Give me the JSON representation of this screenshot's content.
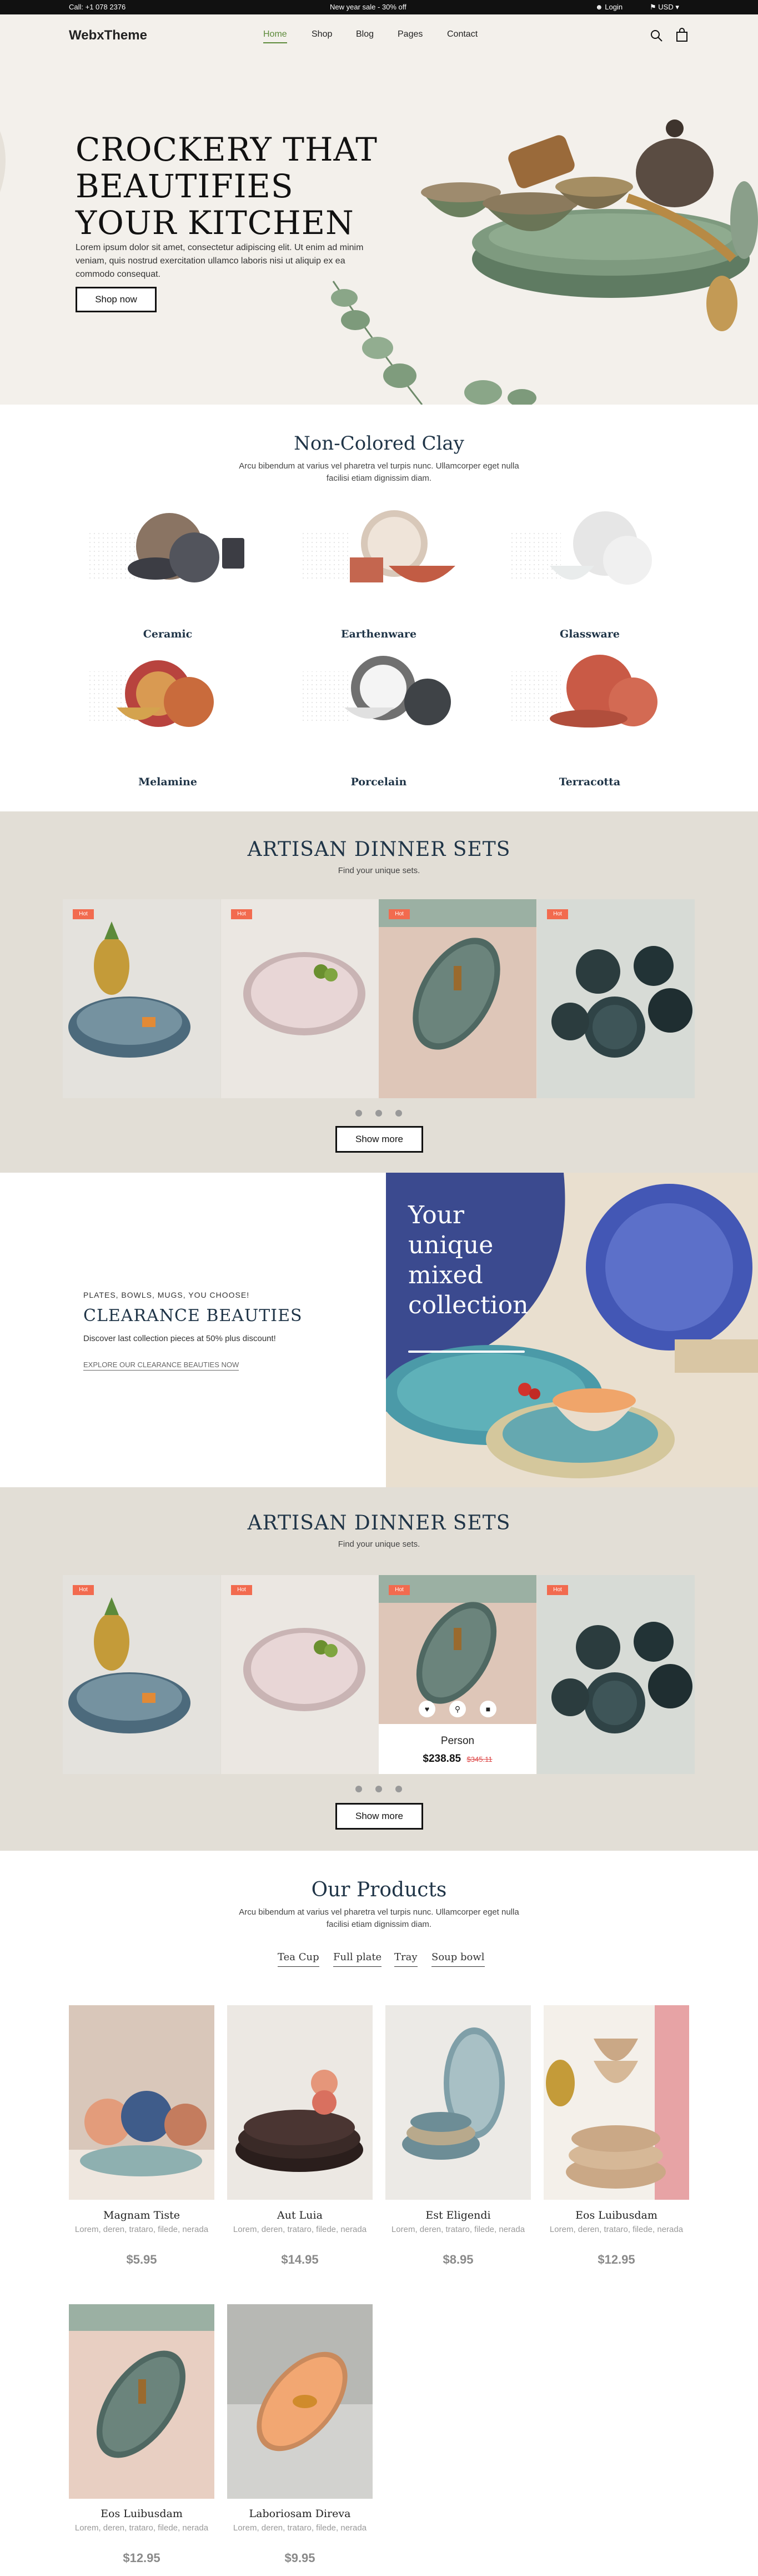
{
  "topbar": {
    "call": "Call: +1 078 2376",
    "promo": "New year sale - 30% off",
    "login": "Login",
    "currency": "USD"
  },
  "nav": {
    "logo": "WebxTheme",
    "links": [
      "Home",
      "Shop",
      "Blog",
      "Pages",
      "Contact"
    ]
  },
  "hero": {
    "title": "CROCKERY THAT BEAUTIFIES YOUR KITCHEN",
    "text": "Lorem ipsum dolor sit amet, consectetur adipiscing elit. Ut enim ad minim veniam, quis nostrud exercitation ullamco laboris nisi ut aliquip ex ea commodo consequat.",
    "button": "Shop now"
  },
  "categories": {
    "title": "Non-Colored Clay",
    "subtitle": "Arcu bibendum at varius vel pharetra vel turpis nunc. Ullamcorper eget nulla facilisi etiam dignissim diam.",
    "items": [
      "Ceramic",
      "Earthenware",
      "Glassware",
      "Melamine",
      "Porcelain",
      "Terracotta"
    ]
  },
  "artisan1": {
    "title": "ARTISAN DINNER SETS",
    "subtitle": "Find your unique sets.",
    "badge": "Hot",
    "button": "Show more"
  },
  "clearance": {
    "kicker": "PLATES, BOWLS, MUGS, YOU CHOOSE!",
    "title": "CLEARANCE BEAUTIES",
    "text": "Discover last collection pieces at 50% plus discount!",
    "link": "EXPLORE OUR CLEARANCE BEAUTIES NOW",
    "banner": "Your unique mixed collection"
  },
  "artisan2": {
    "title": "ARTISAN DINNER SETS",
    "subtitle": "Find your unique sets.",
    "badge": "Hot",
    "button": "Show more",
    "hover_product": {
      "name": "Person",
      "price": "$238.85",
      "old_price": "$345.11"
    }
  },
  "products": {
    "title": "Our Products",
    "subtitle": "Arcu bibendum at varius vel pharetra vel turpis nunc. Ullamcorper eget nulla facilisi etiam dignissim diam.",
    "tabs": [
      "Tea Cup",
      "Full plate",
      "Tray",
      "Soup bowl"
    ],
    "items": [
      {
        "name": "Magnam Tiste",
        "desc": "Lorem, deren, trataro, filede, nerada",
        "price": "$5.95"
      },
      {
        "name": "Aut Luia",
        "desc": "Lorem, deren, trataro, filede, nerada",
        "price": "$14.95"
      },
      {
        "name": "Est Eligendi",
        "desc": "Lorem, deren, trataro, filede, nerada",
        "price": "$8.95"
      },
      {
        "name": "Eos Luibusdam",
        "desc": "Lorem, deren, trataro, filede, nerada",
        "price": "$12.95"
      },
      {
        "name": "Eos Luibusdam",
        "desc": "Lorem, deren, trataro, filede, nerada",
        "price": "$12.95"
      },
      {
        "name": "Laboriosam Direva",
        "desc": "Lorem, deren, trataro, filede, nerada",
        "price": "$9.95"
      }
    ]
  },
  "colors": {
    "accent": "#5c8a3a",
    "navy": "#1f3447",
    "badge": "#f26b4f",
    "slider_bg": "#e2ded6",
    "hero_bg": "#f3f0eb"
  }
}
